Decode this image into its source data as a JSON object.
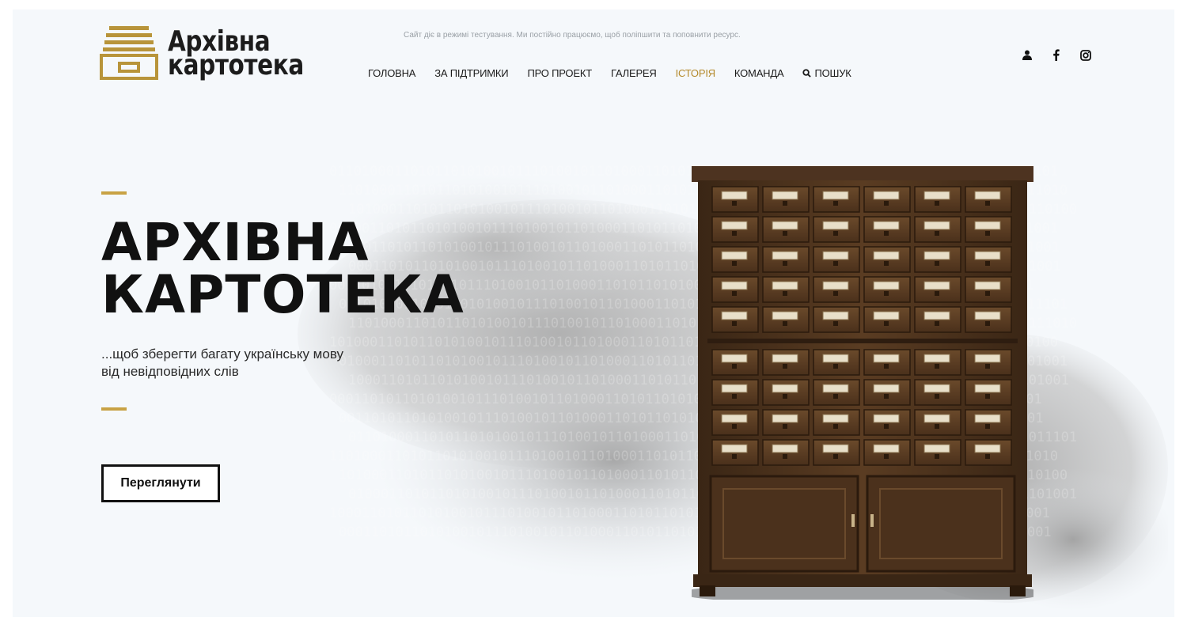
{
  "brand": {
    "line1": "Архівна",
    "line2": "картотека"
  },
  "notice": "Сайт діє в режимі тестування. Ми постійно працюємо, щоб поліпшити та поповнити ресурс.",
  "nav": {
    "items": [
      {
        "label": "ГОЛОВНА"
      },
      {
        "label": "ЗА ПІДТРИМКИ"
      },
      {
        "label": "ПРО ПРОЕКТ"
      },
      {
        "label": "ГАЛЕРЕЯ"
      },
      {
        "label": "ІСТОРІЯ"
      },
      {
        "label": "КОМАНДА"
      }
    ],
    "search_label": "ПОШУК",
    "search_icon": "search-icon"
  },
  "social": {
    "icons": [
      "user-icon",
      "facebook-icon",
      "instagram-icon"
    ]
  },
  "hero": {
    "title_line1": "АРХІВНА",
    "title_line2": "КАРТОТЕКА",
    "subtitle_line1": "...щоб зберегти багату українську мову",
    "subtitle_line2": "від невідповідних слів",
    "cta_label": "Переглянути"
  },
  "colors": {
    "accent": "#c8a244",
    "nav_accent": "#b48a2c",
    "background": "#f5f8fb",
    "text": "#111111"
  }
}
